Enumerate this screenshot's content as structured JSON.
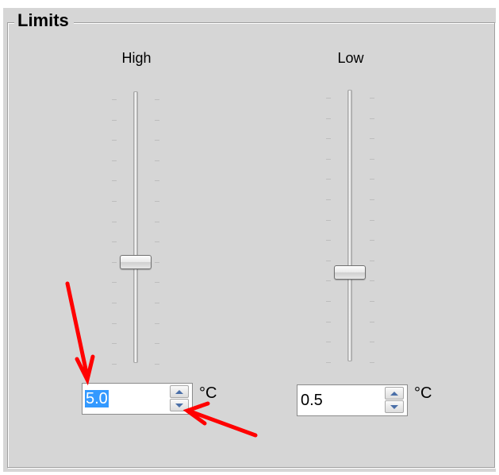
{
  "group": {
    "title": "Limits"
  },
  "high": {
    "label": "High",
    "value": "5.0",
    "unit": "°C",
    "value_selected": true
  },
  "low": {
    "label": "Low",
    "value": "0.5",
    "unit": "°C"
  },
  "colors": {
    "annotation_arrow": "#ff0000",
    "selection": "#3399ff"
  },
  "icons": {
    "spin_up": "triangle-up",
    "spin_down": "triangle-down"
  }
}
